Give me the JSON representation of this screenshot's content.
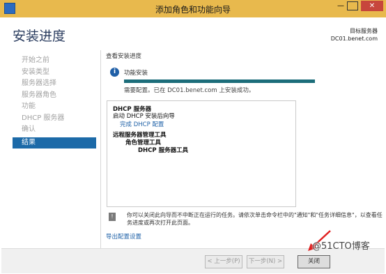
{
  "window": {
    "title": "添加角色和功能向导"
  },
  "header": {
    "page_title": "安装进度",
    "server_label": "目标服务器",
    "server_name": "DC01.benet.com"
  },
  "nav": [
    {
      "label": "开始之前"
    },
    {
      "label": "安装类型"
    },
    {
      "label": "服务器选择"
    },
    {
      "label": "服务器角色"
    },
    {
      "label": "功能"
    },
    {
      "label": "DHCP 服务器"
    },
    {
      "label": "确认"
    },
    {
      "label": "结果"
    }
  ],
  "main": {
    "section_heading": "查看安装进度",
    "feature_label": "功能安装",
    "progress_fraction": 1.0,
    "status": "需要配置。已在 DC01.benet.com 上安装成功。",
    "results": {
      "dhcp_title": "DHCP 服务器",
      "dhcp_sub": "启动 DHCP 安装后向导",
      "dhcp_link": "完成 DHCP 配置",
      "rsat_title": "远程服务器管理工具",
      "role_tools": "角色管理工具",
      "dhcp_tools": "DHCP 服务器工具"
    },
    "note": "你可以关闭此向导而不中断正在运行的任务。请依次单击命令栏中的\"通知\"和\"任务详细信息\"，以查看任务进度或再次打开此页面。",
    "export_link": "导出配置设置"
  },
  "footer": {
    "prev": "< 上一步(P)",
    "next": "下一步(N) >",
    "close": "关闭"
  },
  "watermark": "@51CTO博客"
}
